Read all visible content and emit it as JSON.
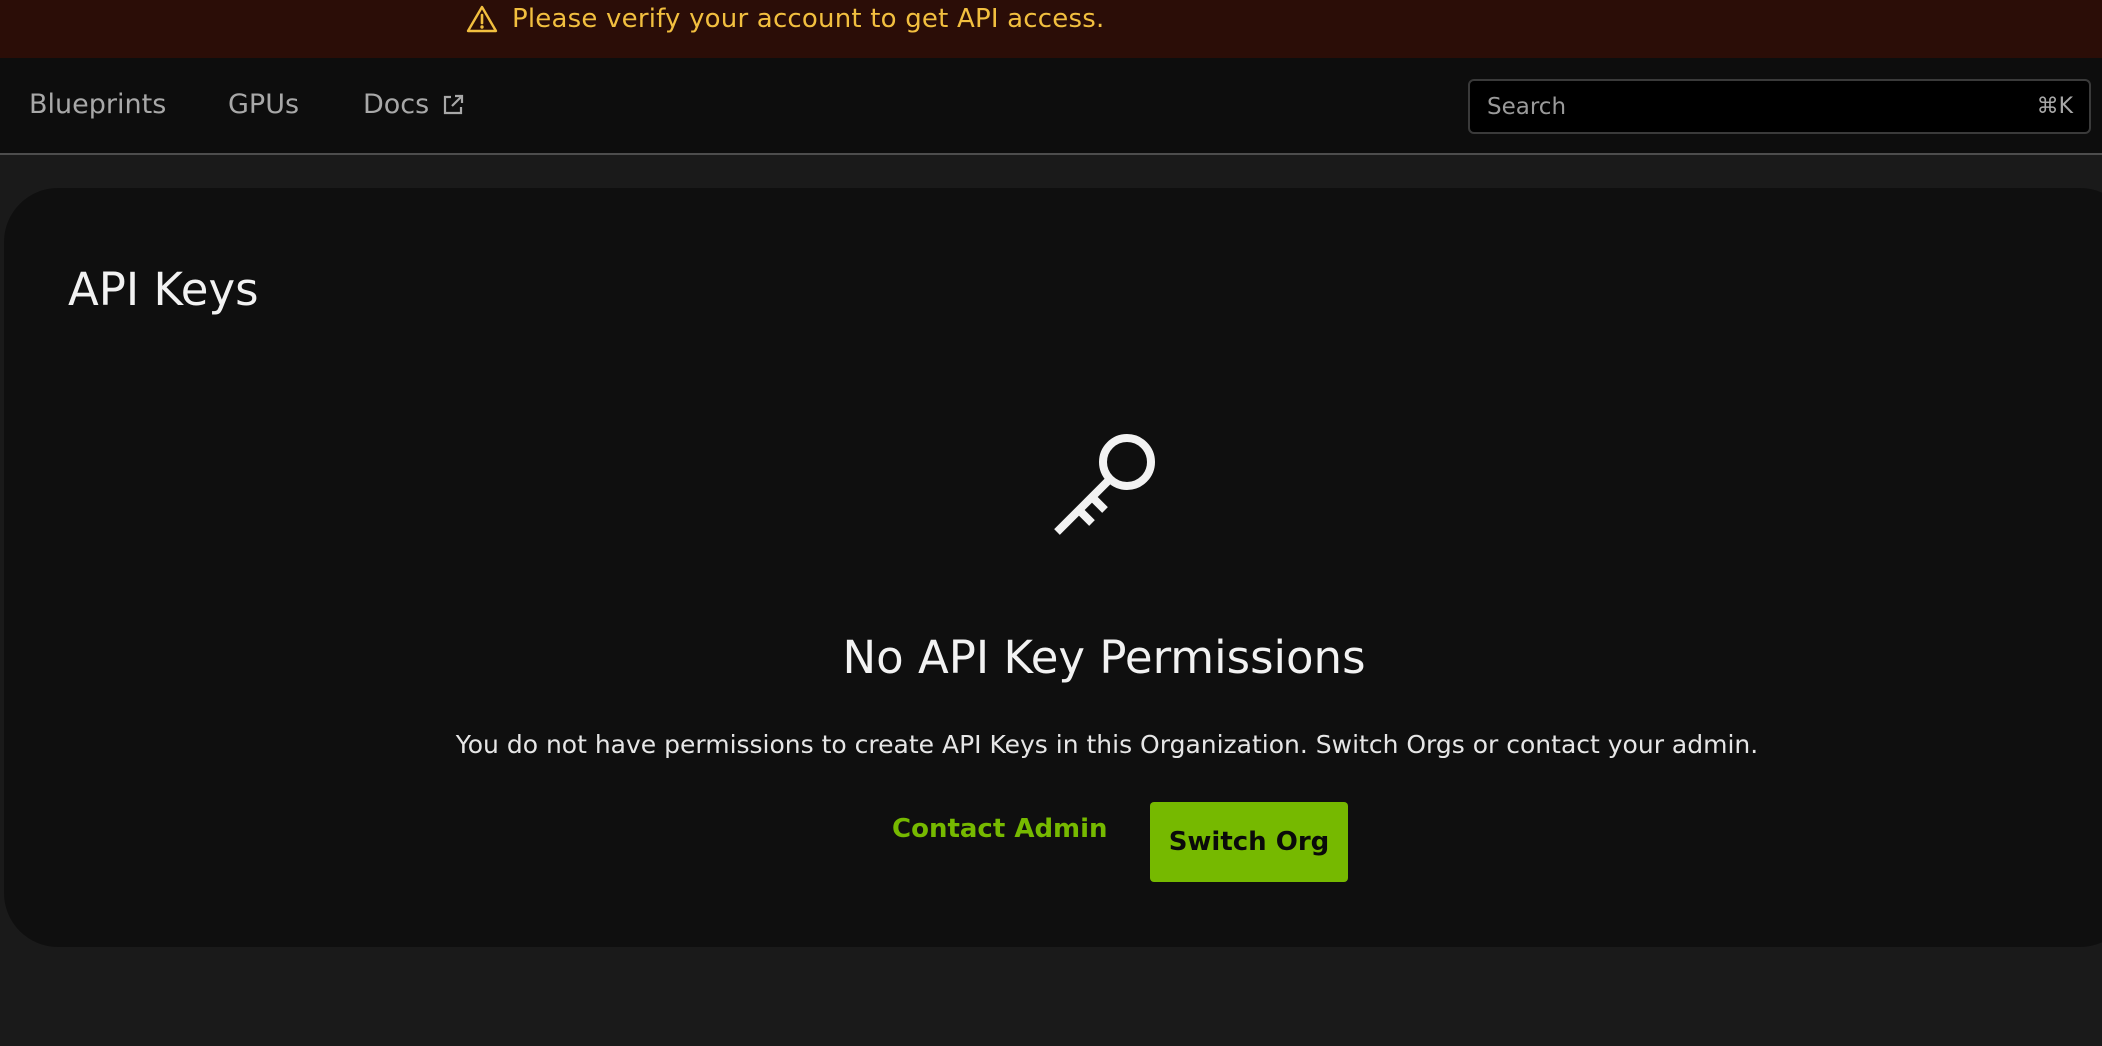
{
  "banner": {
    "message": "Please verify your account to get API access.",
    "icon": "warning-triangle-icon",
    "text_color": "#f2bf3f",
    "background": "#2b0d07"
  },
  "nav": {
    "items": [
      {
        "label": "Blueprints"
      },
      {
        "label": "GPUs"
      },
      {
        "label": "Docs",
        "icon": "external-link-icon"
      }
    ]
  },
  "search": {
    "placeholder": "Search",
    "shortcut": "⌘K"
  },
  "page": {
    "title": "API Keys"
  },
  "empty_state": {
    "icon": "key-icon",
    "title": "No API Key Permissions",
    "description": "You do not have permissions to create API Keys in this Organization. Switch Orgs or contact your admin.",
    "secondary_action": "Contact Admin",
    "primary_action": "Switch Org",
    "accent_color": "#76b900"
  }
}
